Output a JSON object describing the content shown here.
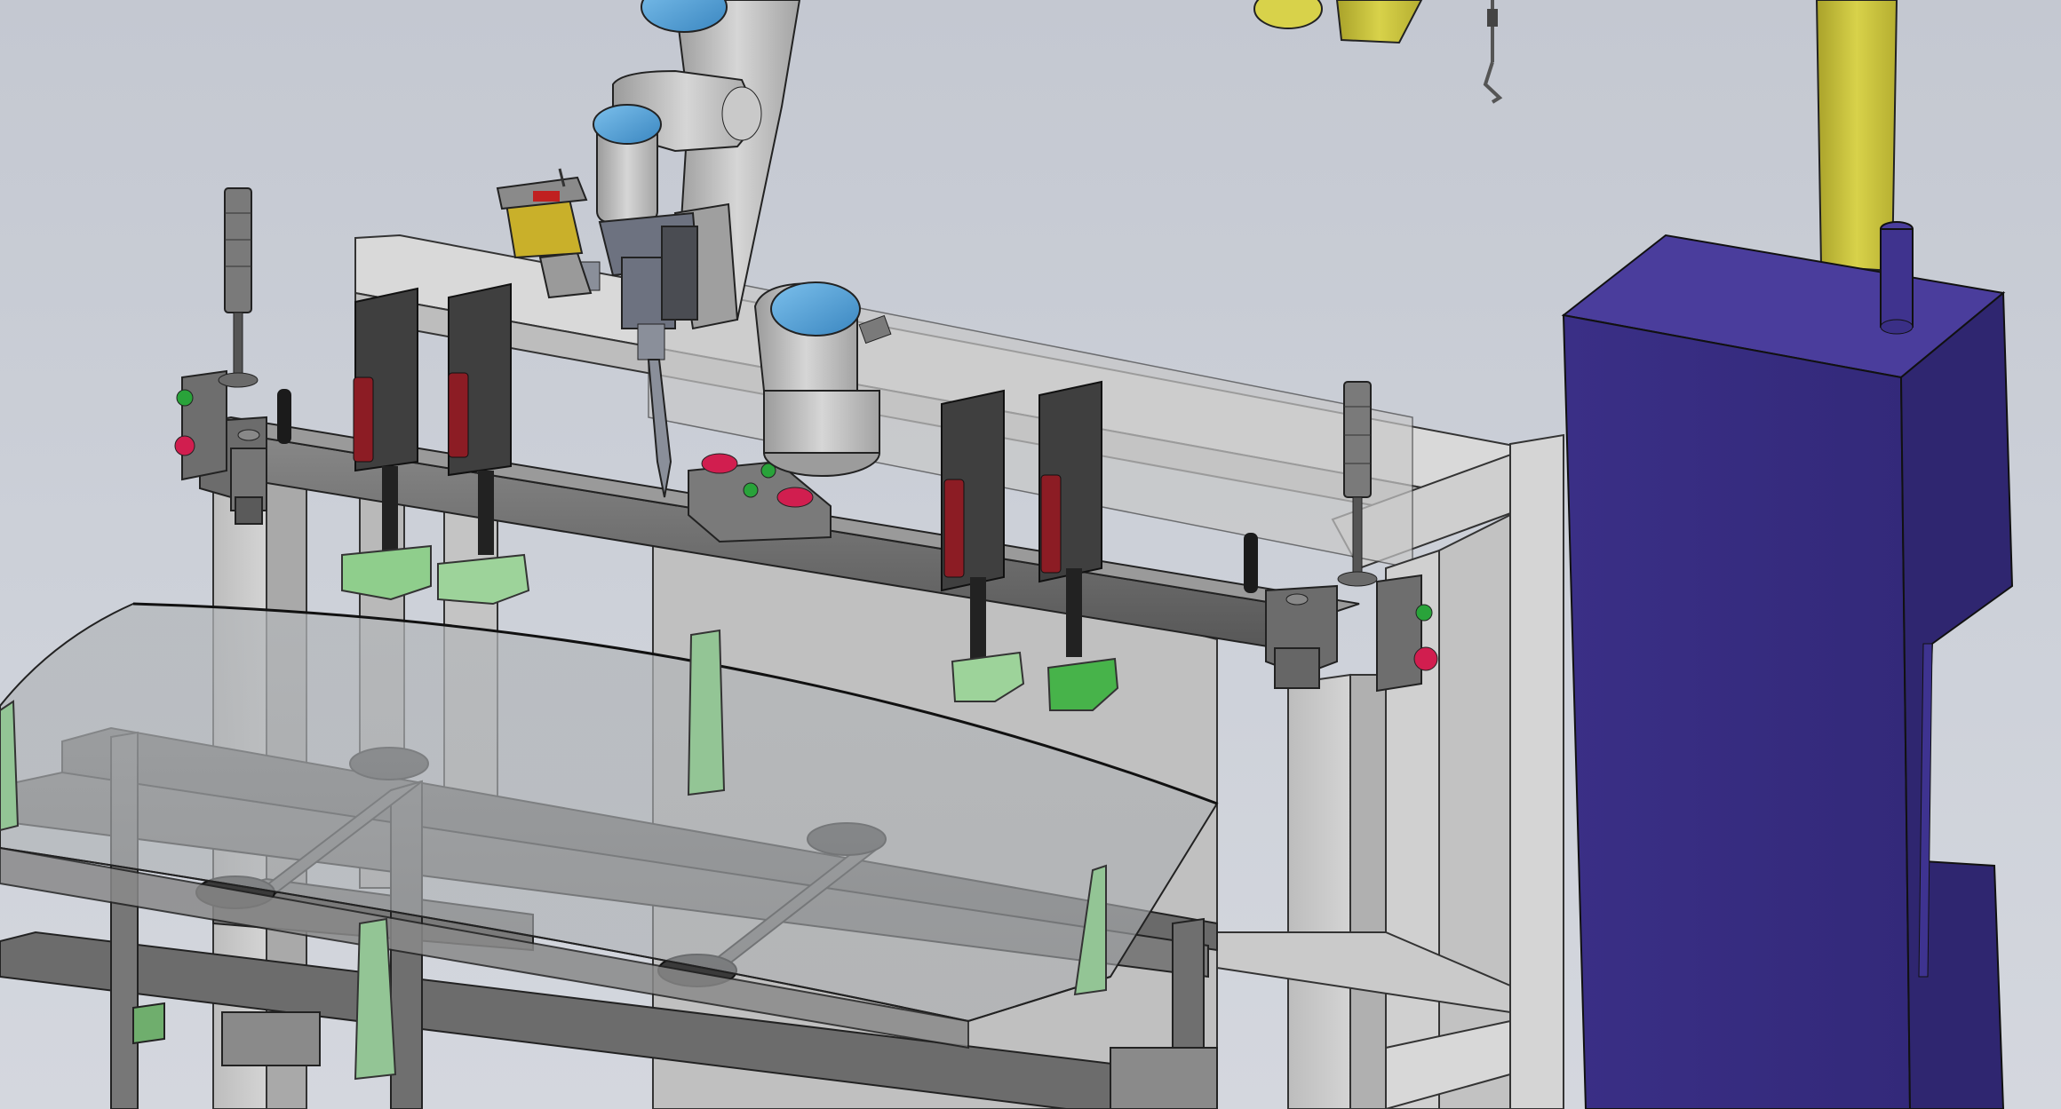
{
  "scene": {
    "kind": "3d-cad-model-viewport",
    "background_color": "#c9cdd6",
    "components": [
      {
        "name": "fixture-frame",
        "color": "#c4c4c4"
      },
      {
        "name": "front-clamp-beam",
        "color": "#6a6a6a"
      },
      {
        "name": "toggle-clamps",
        "count": 4,
        "color": "#3f3f3f",
        "accent": "#8c1c24"
      },
      {
        "name": "clamp-pads",
        "count": 4,
        "color": "#8fce8c"
      },
      {
        "name": "collaborative-robot-arm",
        "color": "#b8b8b8",
        "joint_cap_color": "#4c9fd6"
      },
      {
        "name": "robot-tool-gripper",
        "color": "#6d7280"
      },
      {
        "name": "signal-tower-lights",
        "count": 2,
        "color": "#7a7a7a"
      },
      {
        "name": "control-buttons",
        "colors": [
          "#d11e4f",
          "#29a33a"
        ]
      },
      {
        "name": "curved-glass-panel",
        "color": "#b9bcbf"
      },
      {
        "name": "panel-support-rack",
        "color": "#6a6a6a"
      },
      {
        "name": "vacuum-suction-cups",
        "count": 5,
        "color": "#3a3a3a"
      },
      {
        "name": "glass-locator-blocks",
        "count": 5,
        "color": "#93c595"
      },
      {
        "name": "electrical-cabinet",
        "color": "#3a2f86"
      },
      {
        "name": "yellow-column",
        "color": "#c8c23a"
      },
      {
        "name": "overhead-yellow-bracket",
        "color": "#c8c23a"
      },
      {
        "name": "hanging-chain-hook",
        "color": "#555555"
      }
    ]
  }
}
